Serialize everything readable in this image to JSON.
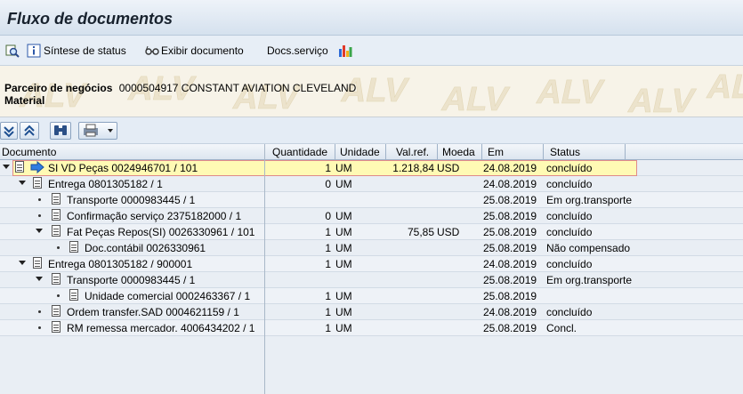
{
  "window": {
    "title": "Fluxo de documentos"
  },
  "toolbar": {
    "status_overview": "Síntese de status",
    "display_document": "Exibir documento",
    "service_docs": "Docs.serviço"
  },
  "header": {
    "partner_label": "Parceiro de negócios",
    "partner_value": "0000504917 CONSTANT AVIATION CLEVELAND",
    "material_label": "Material",
    "watermark": "ALV"
  },
  "columns": {
    "document": "Documento",
    "quantity": "Quantidade",
    "unit": "Unidade",
    "value": "Val.ref.",
    "currency": "Moeda",
    "on": "Em",
    "status": "Status"
  },
  "rows": [
    {
      "doc": "SI VD Peças 0024946701 / 101",
      "qty": "1",
      "unit": "UM",
      "value": "1.218,84",
      "cur": "USD",
      "date": "24.08.2019",
      "status": "concluído"
    },
    {
      "doc": "Entrega 0801305182 / 1",
      "qty": "0",
      "unit": "UM",
      "value": "",
      "cur": "",
      "date": "24.08.2019",
      "status": "concluído"
    },
    {
      "doc": "Transporte 0000983445 / 1",
      "qty": "",
      "unit": "",
      "value": "",
      "cur": "",
      "date": "25.08.2019",
      "status": "Em org.transporte"
    },
    {
      "doc": "Confirmação serviço 2375182000 / 1",
      "qty": "0",
      "unit": "UM",
      "value": "",
      "cur": "",
      "date": "25.08.2019",
      "status": "concluído"
    },
    {
      "doc": "Fat Peças Repos(SI) 0026330961 / 101",
      "qty": "1",
      "unit": "UM",
      "value": "75,85",
      "cur": "USD",
      "date": "25.08.2019",
      "status": "concluído"
    },
    {
      "doc": "Doc.contábil 0026330961",
      "qty": "1",
      "unit": "UM",
      "value": "",
      "cur": "",
      "date": "25.08.2019",
      "status": "Não compensado"
    },
    {
      "doc": "Entrega 0801305182 / 900001",
      "qty": "1",
      "unit": "UM",
      "value": "",
      "cur": "",
      "date": "24.08.2019",
      "status": "concluído"
    },
    {
      "doc": "Transporte 0000983445 / 1",
      "qty": "",
      "unit": "",
      "value": "",
      "cur": "",
      "date": "25.08.2019",
      "status": "Em org.transporte"
    },
    {
      "doc": "Unidade comercial 0002463367 / 1",
      "qty": "1",
      "unit": "UM",
      "value": "",
      "cur": "",
      "date": "25.08.2019",
      "status": ""
    },
    {
      "doc": "Ordem transfer.SAD 0004621159 / 1",
      "qty": "1",
      "unit": "UM",
      "value": "",
      "cur": "",
      "date": "24.08.2019",
      "status": "concluído"
    },
    {
      "doc": "RM remessa mercador. 4006434202 / 1",
      "qty": "1",
      "unit": "UM",
      "value": "",
      "cur": "",
      "date": "25.08.2019",
      "status": "Concl."
    }
  ]
}
